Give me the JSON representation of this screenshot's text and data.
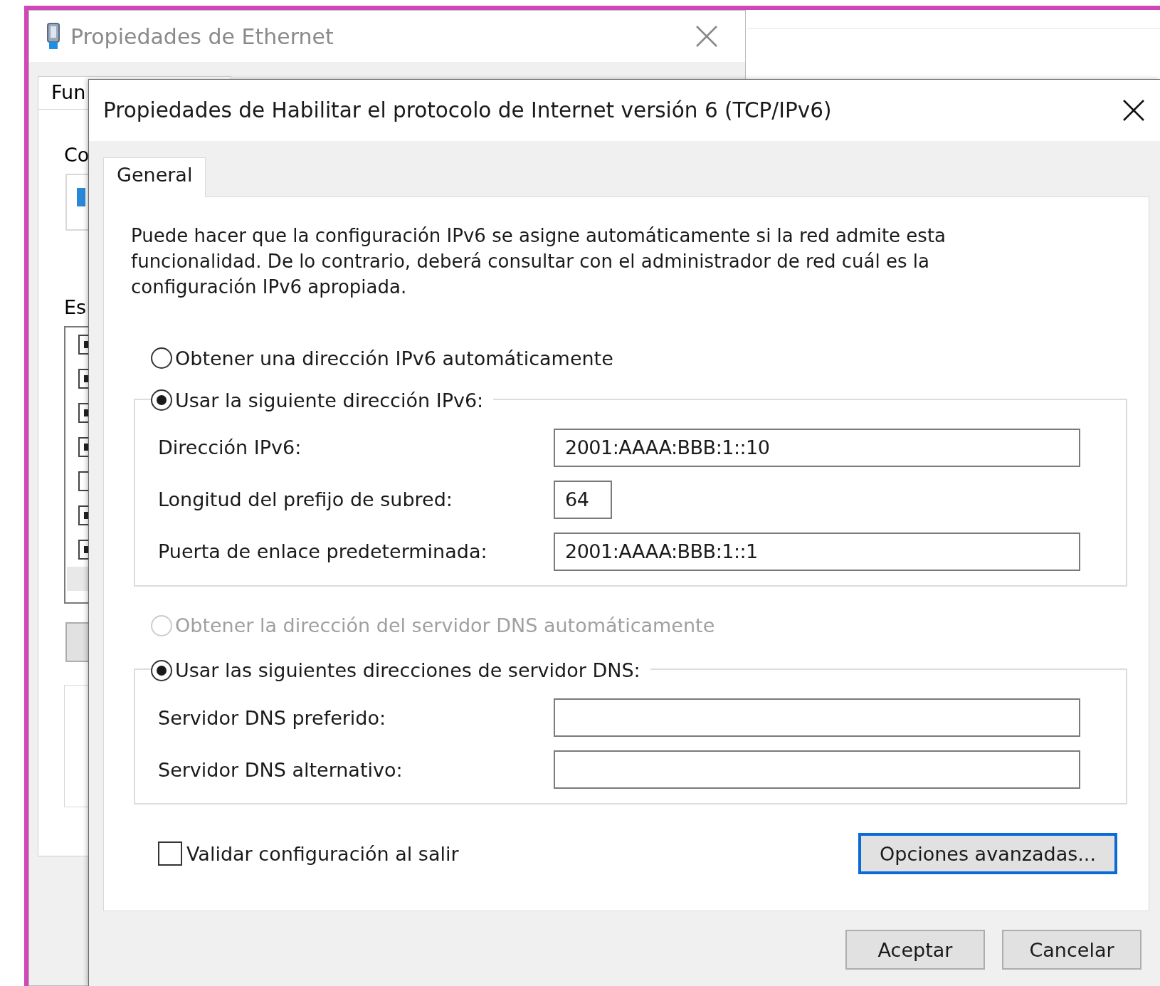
{
  "background_window": {
    "title": "Propiedades de Ethernet",
    "tab": "Fun",
    "labels": [
      "Co",
      "Es"
    ],
    "list_items": [
      {
        "checked": true
      },
      {
        "checked": true
      },
      {
        "checked": true
      },
      {
        "checked": true
      },
      {
        "checked": false
      },
      {
        "checked": true
      },
      {
        "checked": true
      }
    ]
  },
  "dialog": {
    "title": "Propiedades de Habilitar el protocolo de Internet versión 6 (TCP/IPv6)",
    "tabs": [
      {
        "label": "General",
        "selected": true
      }
    ],
    "description": "Puede hacer que la configuración IPv6 se asigne automáticamente si la red admite esta funcionalidad. De lo contrario, deberá consultar con el administrador de red cuál es la configuración IPv6 apropiada.",
    "address_options": [
      {
        "label": "Obtener una dirección IPv6 automáticamente",
        "selected": false,
        "disabled": false
      },
      {
        "label": "Usar la siguiente dirección IPv6:",
        "selected": true,
        "disabled": false
      }
    ],
    "address_fields": [
      {
        "label": "Dirección IPv6:",
        "value": "2001:AAAA:BBB:1::10",
        "kind": "address"
      },
      {
        "label": "Longitud del prefijo de subred:",
        "value": "64",
        "kind": "prefix"
      },
      {
        "label": "Puerta de enlace predeterminada:",
        "value": "2001:AAAA:BBB:1::1",
        "kind": "address"
      }
    ],
    "dns_options": [
      {
        "label": "Obtener la dirección del servidor DNS automáticamente",
        "selected": false,
        "disabled": true
      },
      {
        "label": "Usar las siguientes direcciones de servidor DNS:",
        "selected": true,
        "disabled": false
      }
    ],
    "dns_fields": [
      {
        "label": "Servidor DNS preferido:",
        "kind": "address"
      },
      {
        "label": "Servidor DNS alternativo:",
        "kind": "address"
      }
    ],
    "validate_checkbox": {
      "label": "Validar configuración al salir",
      "checked": false
    },
    "advanced_button": {
      "label": "Opciones avanzadas...",
      "focused": true
    },
    "buttons": [
      "Aceptar",
      "Cancelar"
    ]
  }
}
